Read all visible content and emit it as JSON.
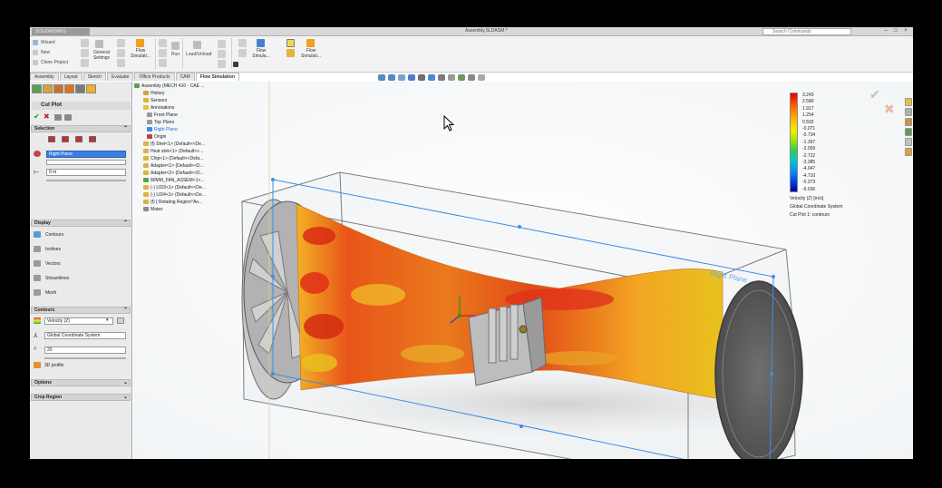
{
  "titlebar": {
    "app_logo": "SOLIDWORKS",
    "doc_title": "Assembly.SLDASM *",
    "search_placeholder": "Search Commands",
    "window_buttons": [
      "–",
      "□",
      "×"
    ]
  },
  "ribbon": {
    "wizard": "Wizard",
    "new": "New",
    "clone_project": "Clone Project",
    "general_settings": [
      "General",
      "Settings"
    ],
    "flow_simulation_1": [
      "Flow",
      "Simulati..."
    ],
    "run": "Run",
    "load_unload": "Load/Unload",
    "flow_simulation_2": [
      "Flow",
      "Simula..."
    ],
    "flow_simulation_3": [
      "Flow",
      "Simulati..."
    ]
  },
  "tabs": [
    "Assembly",
    "Layout",
    "Sketch",
    "Evaluate",
    "Office Products",
    "CAM",
    "Flow Simulation"
  ],
  "active_tab": "Flow Simulation",
  "property_manager": {
    "title": "Cut Plot",
    "selection": {
      "header": "Selection",
      "plane": "Right Plane",
      "offset": "0 m"
    },
    "display": {
      "header": "Display",
      "items": [
        "Contours",
        "Isolines",
        "Vectors",
        "Streamlines",
        "Mesh"
      ]
    },
    "contours": {
      "header": "Contours",
      "parameter": "Velocity (Z)",
      "coord_system": "Global Coordinate System",
      "levels": "20",
      "profile": "3D profile"
    },
    "options_header": "Options",
    "crop_region_header": "Crop Region"
  },
  "tree": {
    "root": "Assembly (MECH 410 - CAE ...",
    "items": [
      "History",
      "Sensors",
      "Annotations",
      "Front Plane",
      "Top Plane",
      "Right Plane",
      "Origin",
      "(f) Shel<1> (Default<<De...",
      "Heat sink<1> (Default<<...",
      "Chip<1> (Default<<Defa...",
      "Adapter<1> (Default<<D...",
      "Adapter<2> (Default<<D...",
      "80MM_FAN_ASSEM<1>...",
      "(-) LID3<1> (Default<<De...",
      "(-) LID4<1> (Default<<De...",
      "(f) [ Rotating Region^As...",
      "Mates"
    ],
    "selected": "Right Plane"
  },
  "legend": {
    "values": [
      "3.243",
      "2.580",
      "1.917",
      "1.254",
      "0.592",
      "-0.071",
      "-0.734",
      "-1.397",
      "-2.059",
      "-2.722",
      "-3.385",
      "-4.047",
      "-4.710",
      "-5.373",
      "-6.036"
    ],
    "caption": [
      "Velocity (Z) [m/s]",
      "Global Coordinate System",
      "Cut Plot 1: contours"
    ]
  },
  "viewport": {
    "plane_label": "Right Plane"
  },
  "colors": {
    "flow_red": "#e23a1a",
    "flow_orange": "#f08a1e",
    "flow_yellow": "#e8d21a",
    "plane_blue": "#3b8ee6"
  }
}
